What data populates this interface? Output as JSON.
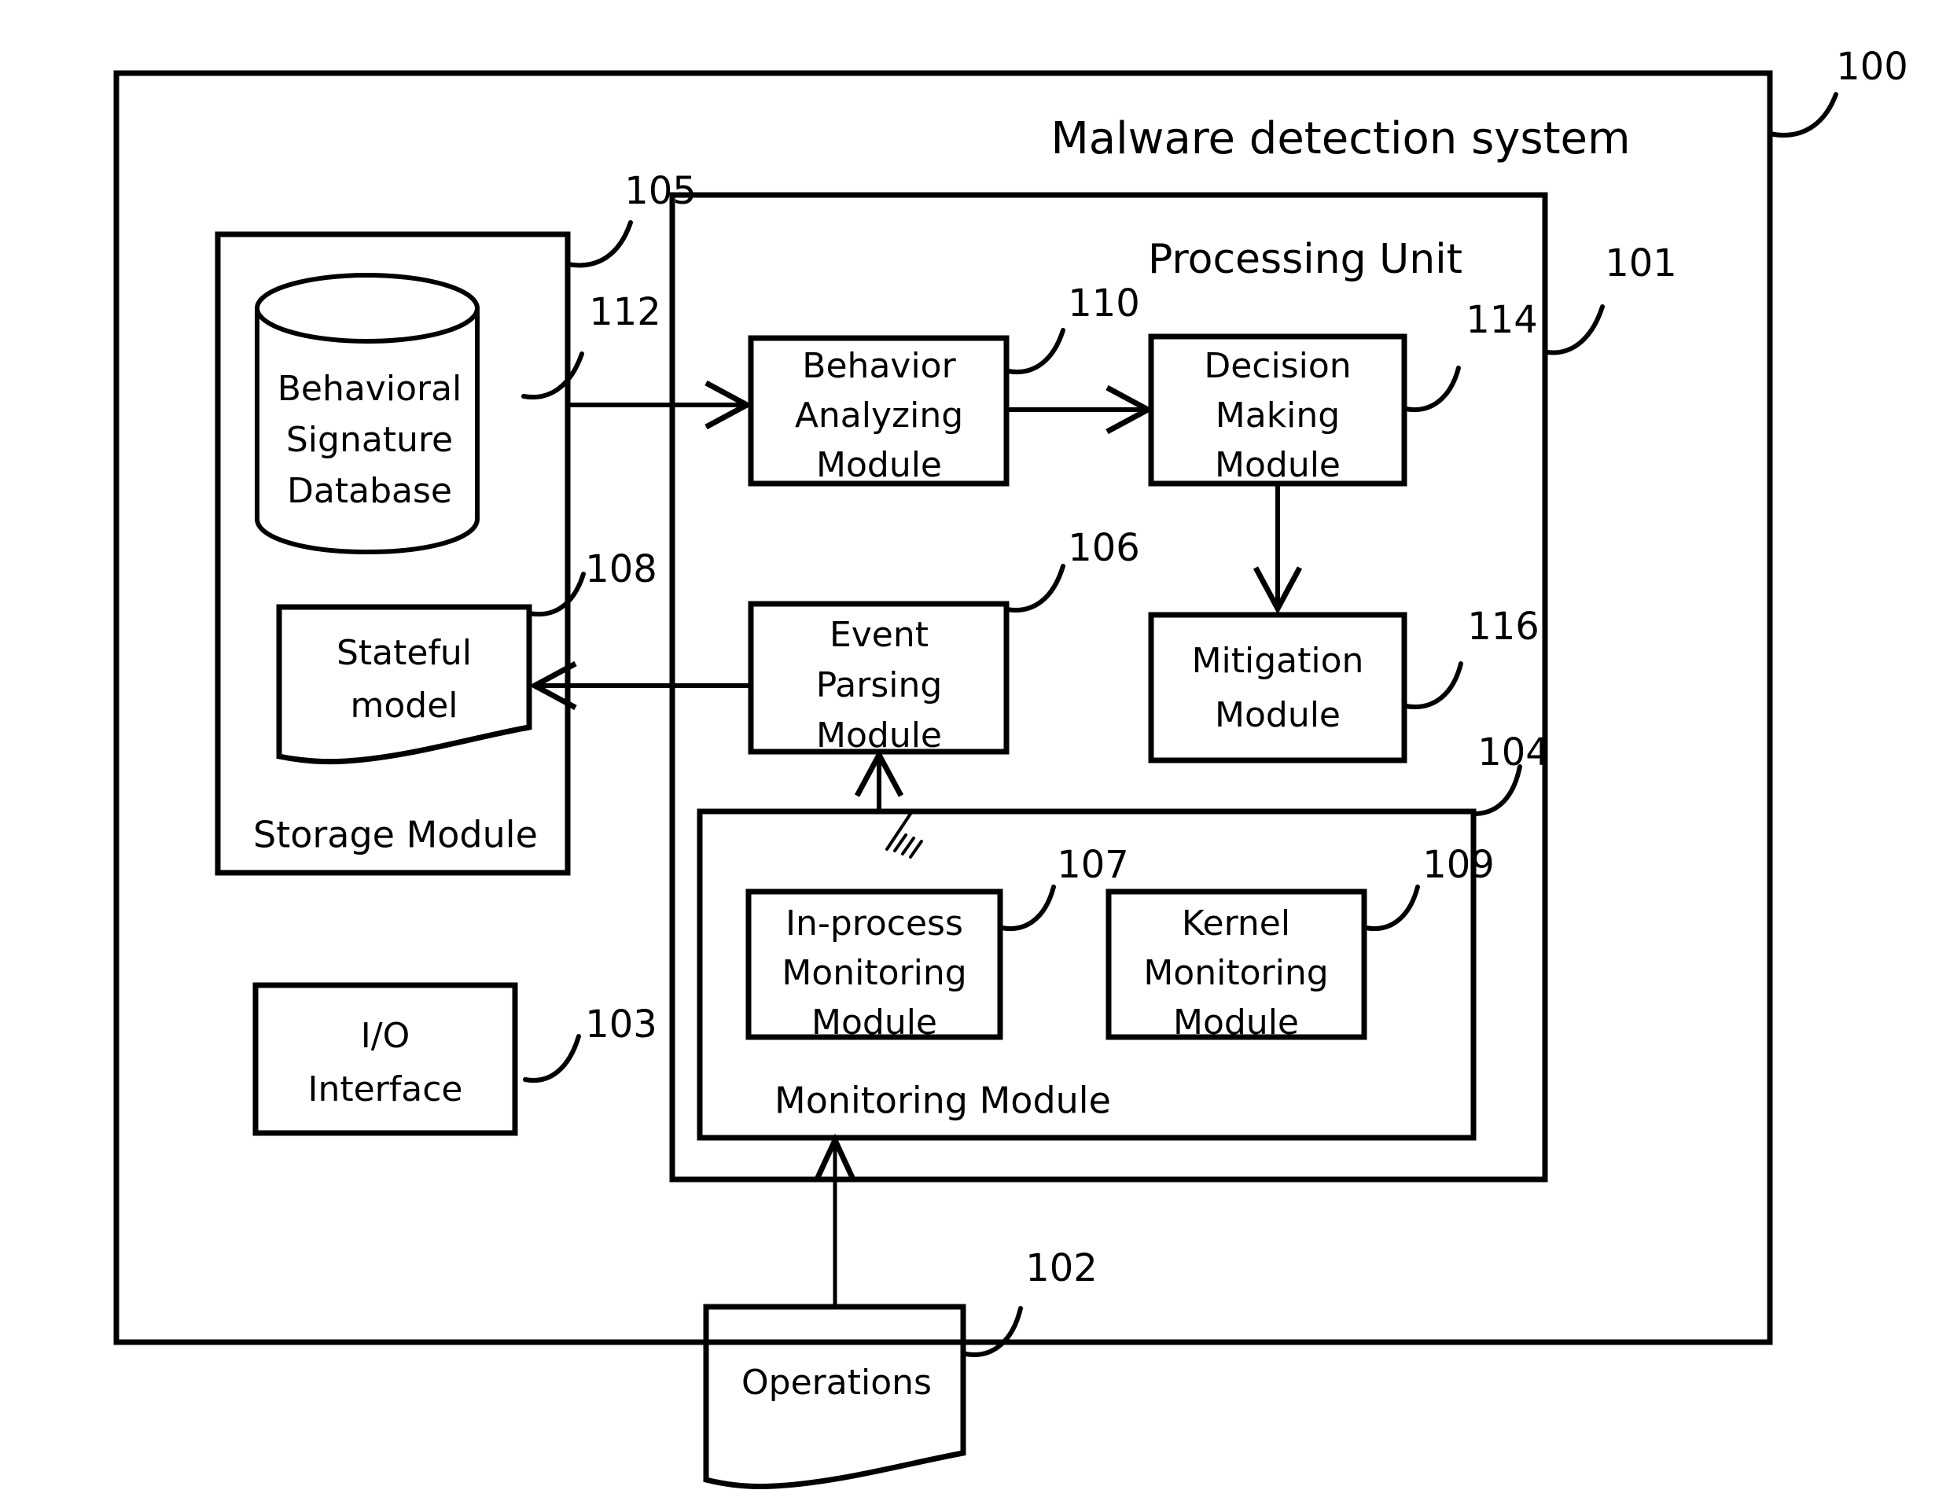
{
  "figure": {
    "title": "Malware detection system",
    "processing_unit_label": "Processing Unit"
  },
  "blocks": {
    "system": {
      "label": "Malware detection system",
      "ref": "100"
    },
    "processing_unit": {
      "label": "Processing Unit",
      "ref": "101"
    },
    "operations": {
      "label": "Operations",
      "ref": "102"
    },
    "io_interface": {
      "label_line1": "I/O",
      "label_line2": "Interface",
      "ref": "103"
    },
    "monitoring_module": {
      "label": "Monitoring Module",
      "ref": "104"
    },
    "storage_module": {
      "label": "Storage Module",
      "ref": "105"
    },
    "event_parsing_module": {
      "label_line1": "Event",
      "label_line2": "Parsing",
      "label_line3": "Module",
      "ref": "106"
    },
    "in_process_monitoring_module": {
      "label_line1": "In-process",
      "label_line2": "Monitoring",
      "label_line3": "Module",
      "ref": "107"
    },
    "stateful_model": {
      "label_line1": "Stateful",
      "label_line2": "model",
      "ref": "108"
    },
    "kernel_monitoring_module": {
      "label_line1": "Kernel",
      "label_line2": "Monitoring",
      "label_line3": "Module",
      "ref": "109"
    },
    "behavior_analyzing_module": {
      "label_line1": "Behavior",
      "label_line2": "Analyzing",
      "label_line3": "Module",
      "ref": "110"
    },
    "behavioral_signature_database": {
      "label_line1": "Behavioral",
      "label_line2": "Signature",
      "label_line3": "Database",
      "ref": "112"
    },
    "decision_making_module": {
      "label_line1": "Decision",
      "label_line2": "Making",
      "label_line3": "Module",
      "ref": "114"
    },
    "mitigation_module": {
      "label_line1": "Mitigation",
      "label_line2": "Module",
      "ref": "116"
    }
  },
  "colors": {
    "stroke": "#000000",
    "background": "#ffffff"
  }
}
